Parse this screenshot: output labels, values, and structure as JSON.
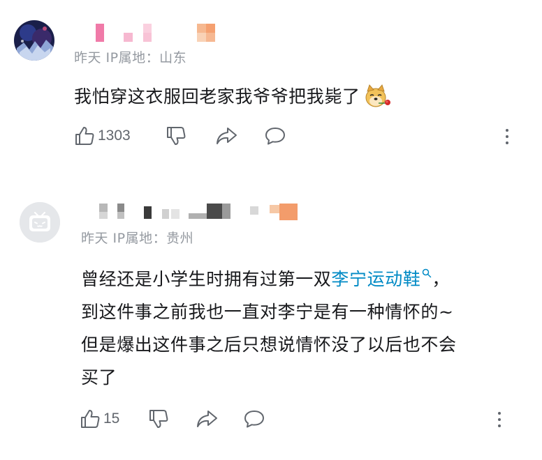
{
  "comments": [
    {
      "meta": "昨天  IP属地：山东",
      "content_lines": [
        "我怕穿这衣服回老家我爷爷把我毙了"
      ],
      "emote_icon": "doge-rose-emoji-icon",
      "like_count": "1303"
    },
    {
      "meta": "昨天  IP属地：贵州",
      "content_line1_before": "曾经还是小学生时拥有过第一双",
      "content_link": "李宁运动鞋",
      "content_line1_after": "，",
      "content_lines": [
        "到这件事之前我也一直对李宁是有一种情怀的~",
        "但是爆出这件事之后只想说情怀没了以后也不会",
        "买了"
      ],
      "like_count": "15"
    }
  ],
  "colors": {
    "link": "#008ac5",
    "meta": "#9499a0",
    "icon": "#61666d",
    "text": "#18191c"
  },
  "icons": [
    "thumb-up-icon",
    "thumb-down-icon",
    "share-icon",
    "reply-icon",
    "more-icon",
    "search-icon"
  ]
}
